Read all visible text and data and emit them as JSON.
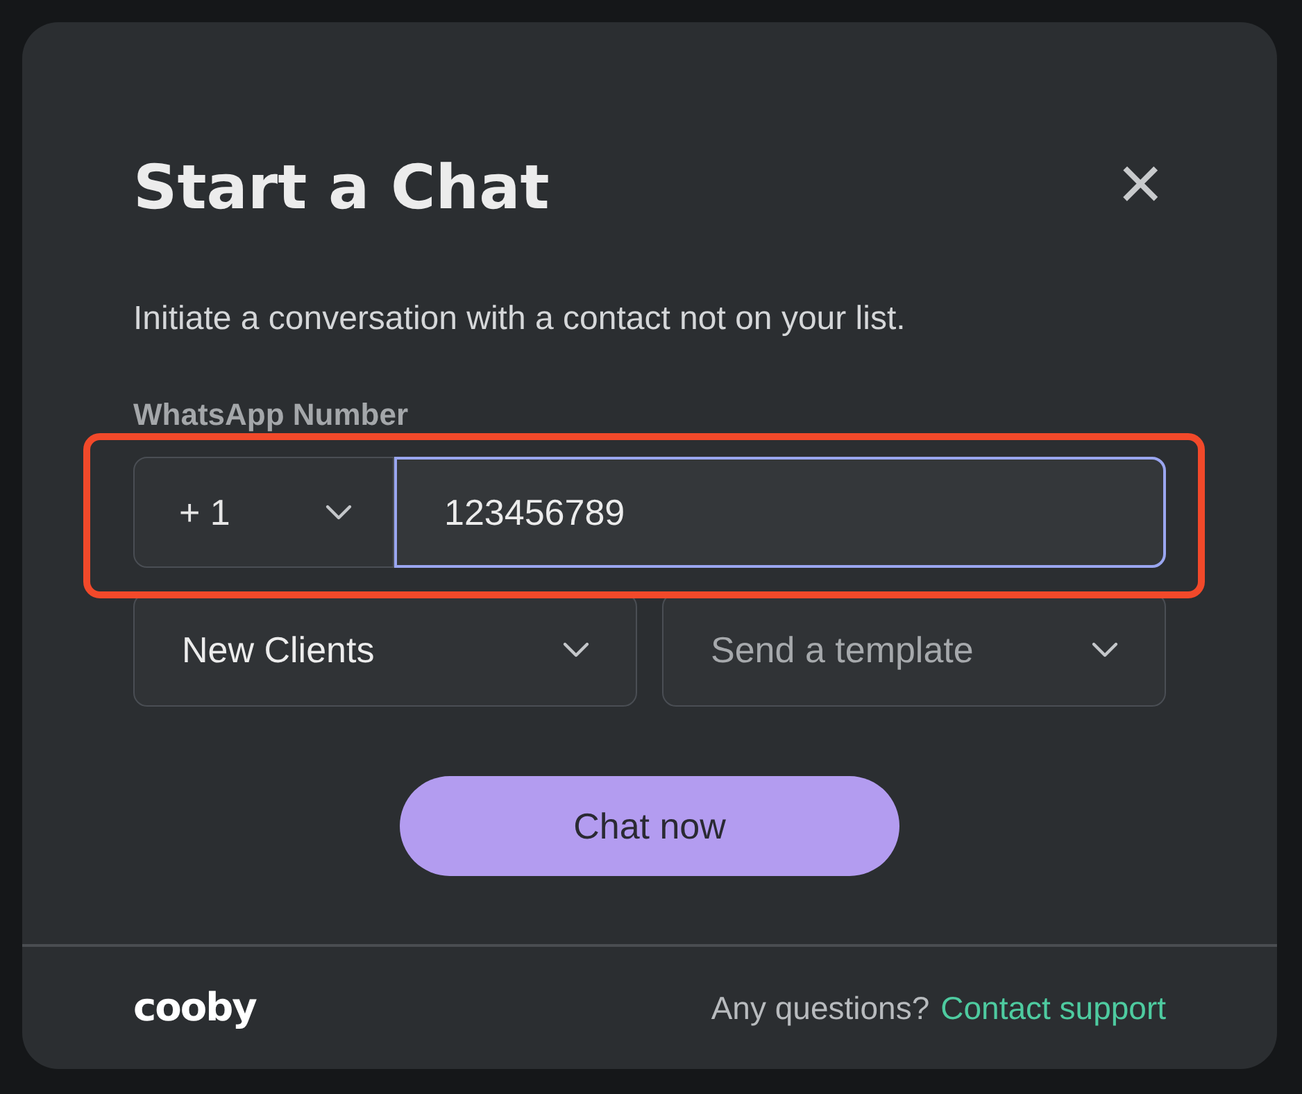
{
  "dialog": {
    "title": "Start a Chat",
    "close_icon": "×",
    "description": "Initiate a conversation with a contact not on your list."
  },
  "phone": {
    "label": "WhatsApp Number",
    "country_code": "+ 1",
    "value": "123456789",
    "focused": true,
    "highlighted": true
  },
  "selects": [
    {
      "value": "New Clients"
    },
    {
      "placeholder": "Send a template"
    }
  ],
  "primary_button": "Chat now",
  "footer": {
    "logo": "cooby",
    "question": "Any questions?",
    "link": "Contact support"
  }
}
